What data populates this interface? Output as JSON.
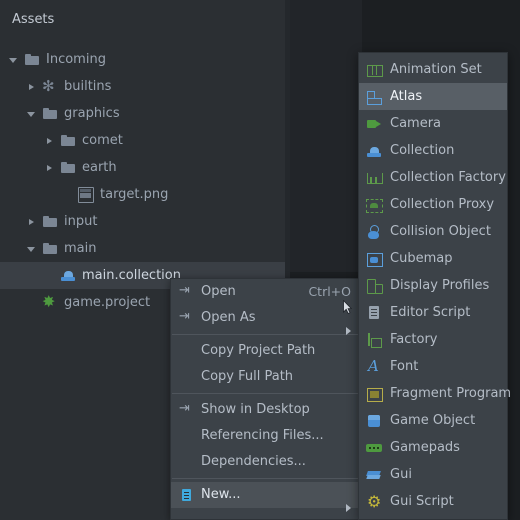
{
  "panel": {
    "title": "Assets",
    "tree": [
      {
        "label": "Incoming",
        "indent": 0,
        "twisty": "open",
        "icon": "folder-icon",
        "selected": false
      },
      {
        "label": "builtins",
        "indent": 1,
        "twisty": "closed",
        "icon": "puzzle-icon",
        "selected": false
      },
      {
        "label": "graphics",
        "indent": 1,
        "twisty": "open",
        "icon": "folder-icon",
        "selected": false
      },
      {
        "label": "comet",
        "indent": 2,
        "twisty": "closed",
        "icon": "folder-icon",
        "selected": false
      },
      {
        "label": "earth",
        "indent": 2,
        "twisty": "closed",
        "icon": "folder-icon",
        "selected": false
      },
      {
        "label": "target.png",
        "indent": 3,
        "twisty": "none",
        "icon": "image-icon",
        "selected": false
      },
      {
        "label": "input",
        "indent": 1,
        "twisty": "closed",
        "icon": "folder-icon",
        "selected": false
      },
      {
        "label": "main",
        "indent": 1,
        "twisty": "open",
        "icon": "folder-icon",
        "selected": false
      },
      {
        "label": "main.collection",
        "indent": 2,
        "twisty": "none",
        "icon": "collection-icon",
        "selected": true
      },
      {
        "label": "game.project",
        "indent": 1,
        "twisty": "none",
        "icon": "project-icon",
        "selected": false
      }
    ]
  },
  "context_menu": {
    "items": [
      {
        "label": "Open",
        "accel": "Ctrl+O",
        "icon": "open-arrow-icon",
        "submenu": false,
        "highlight": false
      },
      {
        "label": "Open As",
        "accel": "",
        "icon": "open-arrow-icon",
        "submenu": true,
        "highlight": false
      },
      {
        "separator": true
      },
      {
        "label": "Copy Project Path",
        "accel": "",
        "icon": "none",
        "submenu": false,
        "highlight": false
      },
      {
        "label": "Copy Full Path",
        "accel": "",
        "icon": "none",
        "submenu": false,
        "highlight": false
      },
      {
        "separator": true
      },
      {
        "label": "Show in Desktop",
        "accel": "",
        "icon": "open-arrow-icon",
        "submenu": false,
        "highlight": false
      },
      {
        "label": "Referencing Files...",
        "accel": "",
        "icon": "none",
        "submenu": false,
        "highlight": false
      },
      {
        "label": "Dependencies...",
        "accel": "",
        "icon": "none",
        "submenu": false,
        "highlight": false
      },
      {
        "separator": true
      },
      {
        "label": "New...",
        "accel": "",
        "icon": "new-document-icon",
        "submenu": true,
        "highlight": true
      }
    ]
  },
  "submenu": {
    "items": [
      {
        "label": "Animation Set",
        "icon": "animation-set-icon",
        "glyph": "g-animset",
        "highlight": false
      },
      {
        "label": "Atlas",
        "icon": "atlas-icon",
        "glyph": "g-atlas",
        "highlight": true
      },
      {
        "label": "Camera",
        "icon": "camera-icon",
        "glyph": "g-camera",
        "highlight": false
      },
      {
        "label": "Collection",
        "icon": "collection-icon",
        "glyph": "g-coll",
        "highlight": false
      },
      {
        "label": "Collection Factory",
        "icon": "collection-factory-icon",
        "glyph": "g-collfac",
        "highlight": false
      },
      {
        "label": "Collection Proxy",
        "icon": "collection-proxy-icon",
        "glyph": "g-collprox",
        "highlight": false
      },
      {
        "label": "Collision Object",
        "icon": "collision-object-icon",
        "glyph": "g-collobj",
        "highlight": false
      },
      {
        "label": "Cubemap",
        "icon": "cubemap-icon",
        "glyph": "g-cubemap",
        "highlight": false
      },
      {
        "label": "Display Profiles",
        "icon": "display-profiles-icon",
        "glyph": "g-display",
        "highlight": false
      },
      {
        "label": "Editor Script",
        "icon": "editor-script-icon",
        "glyph": "g-script",
        "highlight": false
      },
      {
        "label": "Factory",
        "icon": "factory-icon",
        "glyph": "g-factory",
        "highlight": false
      },
      {
        "label": "Font",
        "icon": "font-icon",
        "glyph": "g-font",
        "highlight": false
      },
      {
        "label": "Fragment Program",
        "icon": "fragment-program-icon",
        "glyph": "g-frag",
        "highlight": false
      },
      {
        "label": "Game Object",
        "icon": "game-object-icon",
        "glyph": "g-gameobj",
        "highlight": false
      },
      {
        "label": "Gamepads",
        "icon": "gamepads-icon",
        "glyph": "g-gamepads",
        "highlight": false
      },
      {
        "label": "Gui",
        "icon": "gui-icon",
        "glyph": "g-gui",
        "highlight": false
      },
      {
        "label": "Gui Script",
        "icon": "gui-script-icon",
        "glyph": "g-guiscript",
        "highlight": false
      }
    ]
  },
  "colors": {
    "panel_bg": "#2b2f33",
    "menu_bg": "#3c4248",
    "menu_highlight": "#4b5157",
    "submenu_highlight": "#585f66",
    "selection_bg": "#3a3f45",
    "text": "#b5bdc7",
    "accent_blue": "#4a8fd4",
    "accent_green": "#4e9a3f",
    "accent_yellow": "#c5b83a",
    "window_bg": "#1c1f22"
  }
}
